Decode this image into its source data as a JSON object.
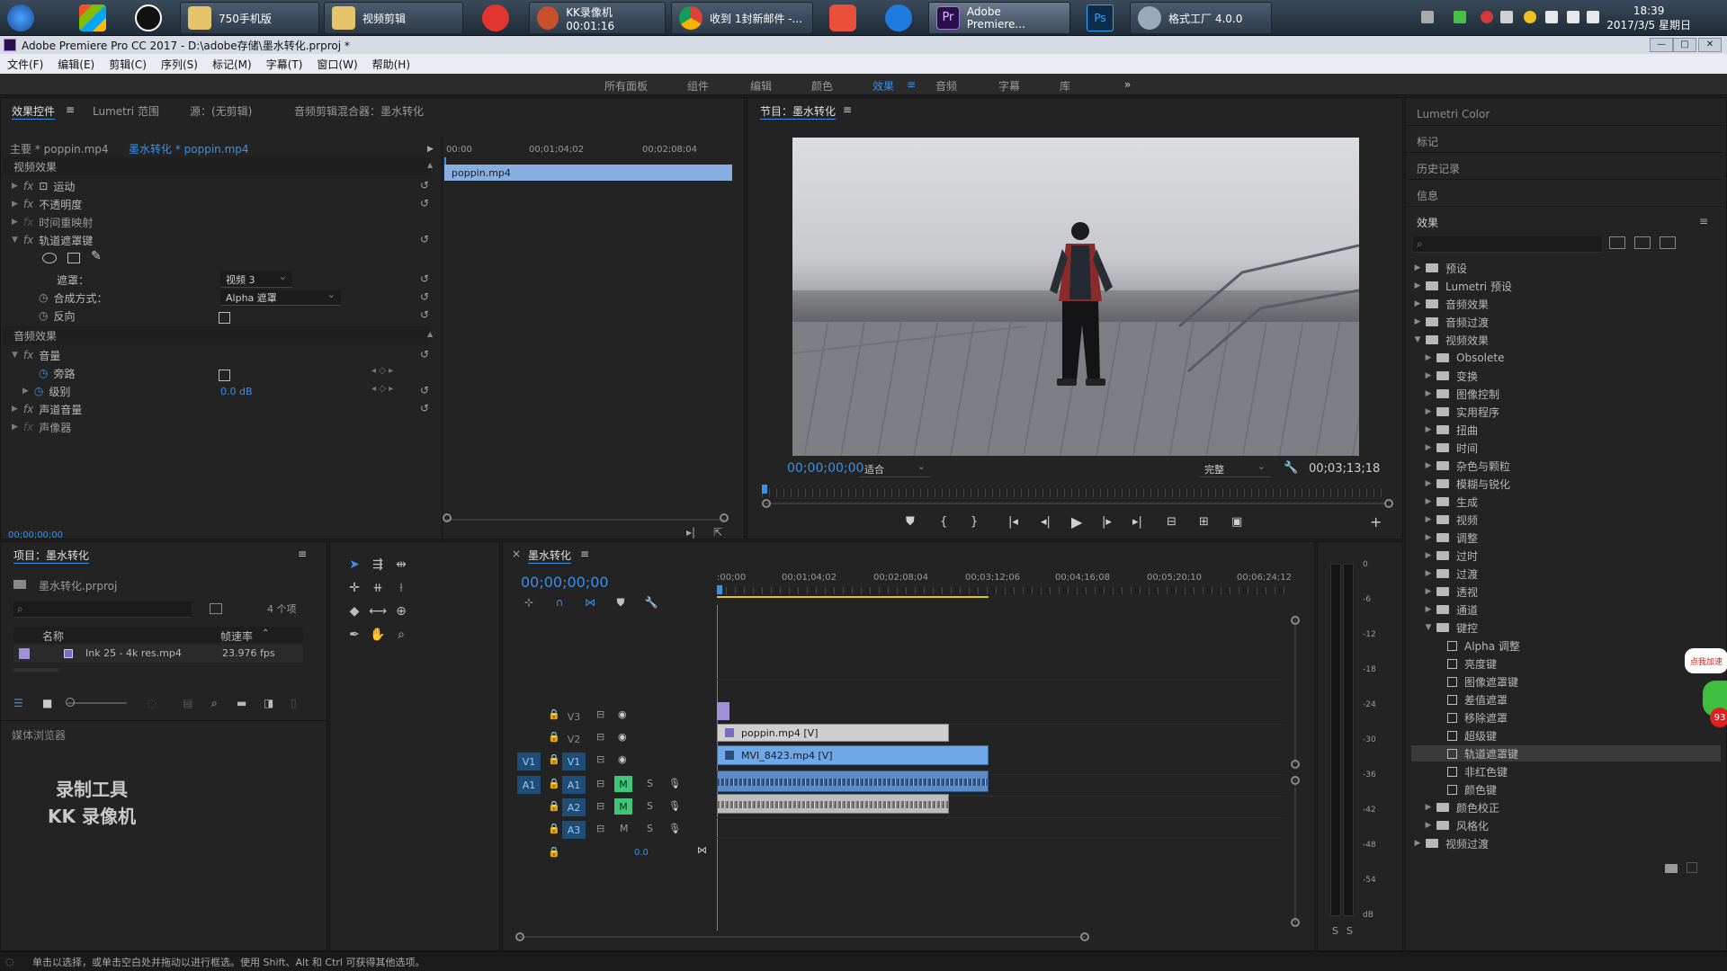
{
  "taskbar": {
    "buttons": [
      {
        "label": "750手机版"
      },
      {
        "label": "视频剪辑"
      },
      {
        "label": "KK录像机 00:01:16"
      },
      {
        "label": "收到 1封新邮件 -..."
      },
      {
        "label": "Adobe Premiere..."
      },
      {
        "label": "格式工厂 4.0.0"
      }
    ],
    "clock_time": "18:39",
    "clock_date": "2017/3/5 星期日"
  },
  "window": {
    "title": "Adobe Premiere Pro CC 2017 - D:\\adobe存储\\墨水转化.prproj *",
    "min_label": "—",
    "max_label": "□",
    "close_label": "✕"
  },
  "menu": [
    "文件(F)",
    "编辑(E)",
    "剪辑(C)",
    "序列(S)",
    "标记(M)",
    "字幕(T)",
    "窗口(W)",
    "帮助(H)"
  ],
  "workspaces": [
    "所有面板",
    "组件",
    "编辑",
    "颜色",
    "效果",
    "音频",
    "字幕",
    "库"
  ],
  "workspace_active": "效果",
  "workspace_more": "»",
  "effect_controls": {
    "tabs": [
      "效果控件",
      "Lumetri 范围",
      "源：(无剪辑)",
      "音频剪辑混合器：墨水转化"
    ],
    "menu_icon": "≡",
    "master_label": "主要 * poppin.mp4",
    "seq_label": "墨水转化 * poppin.mp4",
    "ruler": [
      "00:00",
      "00;01;04;02",
      "00;02;08;04"
    ],
    "clip_name": "poppin.mp4",
    "video_section": "视频效果",
    "rows": [
      "运动",
      "不透明度",
      "时间重映射",
      "轨道遮罩键"
    ],
    "mask_label": "遮罩：",
    "mask_value": "视频 3",
    "composite_label": "合成方式：",
    "composite_value": "Alpha 遮罩",
    "reverse_label": "反向",
    "audio_section": "音频效果",
    "volume_label": "音量",
    "bypass_label": "旁路",
    "level_label": "级别",
    "level_value": "0.0 dB",
    "channel_volume_label": "声道音量",
    "panner_label": "声像器",
    "timecode": "00;00;00;00"
  },
  "program": {
    "title": "节目：墨水转化",
    "timecode": "00;00;00;00",
    "fit": "适合",
    "quality": "完整",
    "duration": "00;03;13;18",
    "add_label": "+"
  },
  "right_panel": {
    "tabs": [
      "Lumetri Color",
      "标记",
      "历史记录",
      "信息",
      "效果"
    ],
    "tree": [
      {
        "label": "预设",
        "type": "folder",
        "level": 0,
        "open": false
      },
      {
        "label": "Lumetri 预设",
        "type": "folder",
        "level": 0,
        "open": false
      },
      {
        "label": "音频效果",
        "type": "folder",
        "level": 0,
        "open": false
      },
      {
        "label": "音频过渡",
        "type": "folder",
        "level": 0,
        "open": false
      },
      {
        "label": "视频效果",
        "type": "folder",
        "level": 0,
        "open": true
      },
      {
        "label": "Obsolete",
        "type": "folder",
        "level": 1,
        "open": false
      },
      {
        "label": "变换",
        "type": "folder",
        "level": 1,
        "open": false
      },
      {
        "label": "图像控制",
        "type": "folder",
        "level": 1,
        "open": false
      },
      {
        "label": "实用程序",
        "type": "folder",
        "level": 1,
        "open": false
      },
      {
        "label": "扭曲",
        "type": "folder",
        "level": 1,
        "open": false
      },
      {
        "label": "时间",
        "type": "folder",
        "level": 1,
        "open": false
      },
      {
        "label": "杂色与颗粒",
        "type": "folder",
        "level": 1,
        "open": false
      },
      {
        "label": "模糊与锐化",
        "type": "folder",
        "level": 1,
        "open": false
      },
      {
        "label": "生成",
        "type": "folder",
        "level": 1,
        "open": false
      },
      {
        "label": "视频",
        "type": "folder",
        "level": 1,
        "open": false
      },
      {
        "label": "调整",
        "type": "folder",
        "level": 1,
        "open": false
      },
      {
        "label": "过时",
        "type": "folder",
        "level": 1,
        "open": false
      },
      {
        "label": "过渡",
        "type": "folder",
        "level": 1,
        "open": false
      },
      {
        "label": "透视",
        "type": "folder",
        "level": 1,
        "open": false
      },
      {
        "label": "通道",
        "type": "folder",
        "level": 1,
        "open": false
      },
      {
        "label": "键控",
        "type": "folder",
        "level": 1,
        "open": true
      },
      {
        "label": "Alpha 调整",
        "type": "effect",
        "level": 2,
        "open": false
      },
      {
        "label": "亮度键",
        "type": "effect",
        "level": 2,
        "open": false
      },
      {
        "label": "图像遮罩键",
        "type": "effect",
        "level": 2,
        "open": false
      },
      {
        "label": "差值遮罩",
        "type": "effect",
        "level": 2,
        "open": false
      },
      {
        "label": "移除遮罩",
        "type": "effect",
        "level": 2,
        "open": false
      },
      {
        "label": "超级键",
        "type": "effect",
        "level": 2,
        "open": false
      },
      {
        "label": "轨道遮罩键",
        "type": "effect",
        "level": 2,
        "open": false,
        "selected": true
      },
      {
        "label": "非红色键",
        "type": "effect",
        "level": 2,
        "open": false
      },
      {
        "label": "颜色键",
        "type": "effect",
        "level": 2,
        "open": false
      },
      {
        "label": "颜色校正",
        "type": "folder",
        "level": 1,
        "open": false
      },
      {
        "label": "风格化",
        "type": "folder",
        "level": 1,
        "open": false
      },
      {
        "label": "视频过渡",
        "type": "folder",
        "level": 0,
        "open": false
      }
    ],
    "badge": "93",
    "promo": "点我加速"
  },
  "project": {
    "title": "项目：墨水转化",
    "file": "墨水转化.prproj",
    "count": "4 个项",
    "col_name": "名称",
    "col_fps": "帧速率",
    "item_name": "Ink 25 - 4k res.mp4",
    "item_fps": "23.976 fps",
    "media_browser": "媒体浏览器",
    "watermark_line1": "录制工具",
    "watermark_line2": "KK 录像机"
  },
  "timeline": {
    "title": "墨水转化",
    "close_icon": "×",
    "timecode": "00;00;00;00",
    "ruler": [
      ":00;00",
      "00;01;04;02",
      "00;02;08;04",
      "00;03;12;06",
      "00;04;16;08",
      "00;05;20;10",
      "00;06;24;12"
    ],
    "tracks": [
      "V3",
      "V2",
      "V1",
      "A1",
      "A2",
      "A3"
    ],
    "src_v1": "V1",
    "src_a1": "A1",
    "clip_v2": "poppin.mp4 [V]",
    "clip_v1": "MVI_8423.mp4 [V]",
    "master_value": "0.0",
    "m_label": "M",
    "s_label": "S"
  },
  "meter": {
    "scale": [
      "0",
      "-6",
      "-12",
      "-18",
      "-24",
      "-30",
      "-36",
      "-42",
      "-48",
      "-54",
      "dB"
    ],
    "s_left": "S",
    "s_right": "S"
  },
  "status": "单击以选择，或单击空白处并拖动以进行框选。使用 Shift、Alt 和 Ctrl 可获得其他选项。"
}
